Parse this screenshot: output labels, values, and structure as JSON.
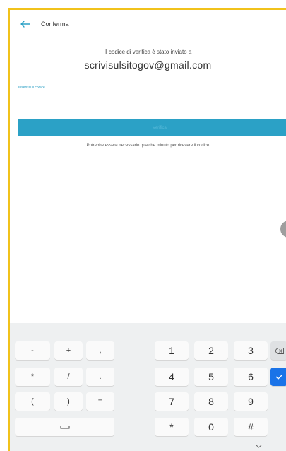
{
  "header": {
    "title": "Conferma",
    "back_icon": "arrow-left-icon"
  },
  "main": {
    "info_text": "Il codice di verifica è stato inviato a",
    "email": "scrivisulsitogov@gmail.com",
    "code_field": {
      "label": "Inserisci il codice",
      "value": ""
    },
    "submit_label": "Verifica",
    "hint": "Potrebbe essere necessario qualche minuto per ricevere il codice"
  },
  "keyboard": {
    "symbols": [
      [
        "-",
        "+",
        ","
      ],
      [
        "*",
        "/",
        "."
      ],
      [
        "(",
        ")",
        "="
      ]
    ],
    "space_icon": "space-bar-icon",
    "digits": [
      [
        "1",
        "2",
        "3"
      ],
      [
        "4",
        "5",
        "6"
      ],
      [
        "7",
        "8",
        "9"
      ],
      [
        "*",
        "0",
        "#"
      ]
    ],
    "backspace_icon": "backspace-icon",
    "enter_icon": "checkmark-icon",
    "collapse_icon": "chevron-down-icon"
  },
  "colors": {
    "accent": "#2ba1c6",
    "frame": "#f1c21b",
    "enter": "#1a73e8"
  }
}
